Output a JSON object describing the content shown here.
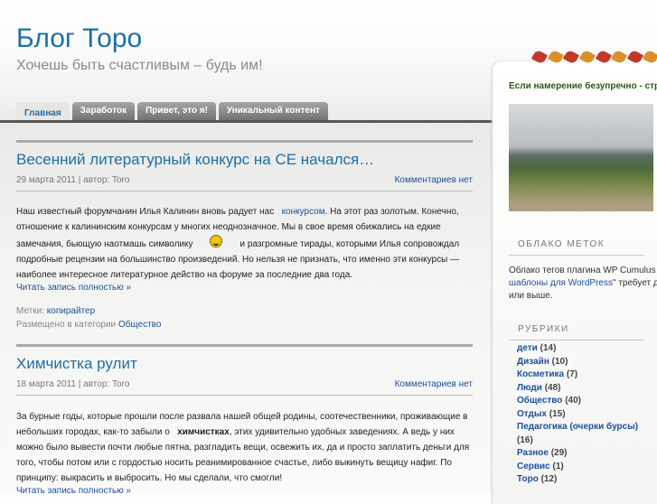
{
  "header": {
    "title": "Блог Торо",
    "tagline": "Хочешь быть счастливым – будь им!"
  },
  "tabs": [
    "Главная",
    "Заработок",
    "Привет, это я!",
    "Уникальный контент"
  ],
  "posts": [
    {
      "title": "Весенний литературный конкурс на СЕ начался…",
      "meta": "29 марта 2011 | автор: Toro",
      "comments": "Комментариев нет",
      "body": {
        "p1": "Наш известный форумчанин Илья Калинин вновь радует нас",
        "link": "конкурсом",
        "p2": ". На этот раз золотым. Конечно, отношение к калининским конкурсам у многих неоднозначное. Мы в свое время обижались на едкие замечания, бьющую наотмашь символику",
        "p3": "и разгромные тирады, которыми Илья сопровождал подробные рецензии на большинство произведений. Но нельзя не признать, что именно эти конкурсы — наиболее интересное литературное действо на форуме за последние два года."
      },
      "read_more": "Читать запись полностью »",
      "tags_label": "Метки:",
      "tag": "копирайтер",
      "category_label": "Размещено в категории",
      "category": "Общество"
    },
    {
      "title": "Химчистка рулит",
      "meta": "18 марта 2011 | автор: Toro",
      "comments": "Комментариев нет",
      "body": {
        "p1": "За бурные годы, которые прошли после развала нашей общей родины, соотечественники, проживающие в небольших городах, как-то забыли о",
        "bold": "химчистках",
        "p2": ", этих удивительно удобных заведениях. А ведь у них можно было вывести почти любые пятна, разгладить вещи, освежить их, да и просто заплатить деньги для того, чтобы потом или с гордостью носить реанимированное счастье, либо выкинуть вещицу нафиг. По принципу: выкрасить и выбросить. Но мы сделали, что смогли!"
      },
      "read_more": "Читать запись полностью »"
    }
  ],
  "sidebar": {
    "quote": "Если намерение безупречно - стр",
    "cloud_title": "ОБЛАКО МЕТОК",
    "cloud_text1": "Облако тегов плагина WP Cumulus",
    "cloud_link": "шаблоны для WordPress",
    "cloud_text2": "\" требует д",
    "cloud_text3": "или выше.",
    "cats_title": "РУБРИКИ",
    "categories": [
      {
        "name": "дети",
        "count": "(14)"
      },
      {
        "name": "Дизайн",
        "count": "(10)"
      },
      {
        "name": "Косметика",
        "count": "(7)"
      },
      {
        "name": "Люди",
        "count": "(48)"
      },
      {
        "name": "Общество",
        "count": "(40)"
      },
      {
        "name": "Отдых",
        "count": "(15)"
      },
      {
        "name": "Педагогика (очерки бурсы)",
        "count": "(16)"
      },
      {
        "name": "Разное",
        "count": "(29)"
      },
      {
        "name": "Сервис",
        "count": "(1)"
      },
      {
        "name": "Торо",
        "count": "(12)"
      }
    ]
  }
}
